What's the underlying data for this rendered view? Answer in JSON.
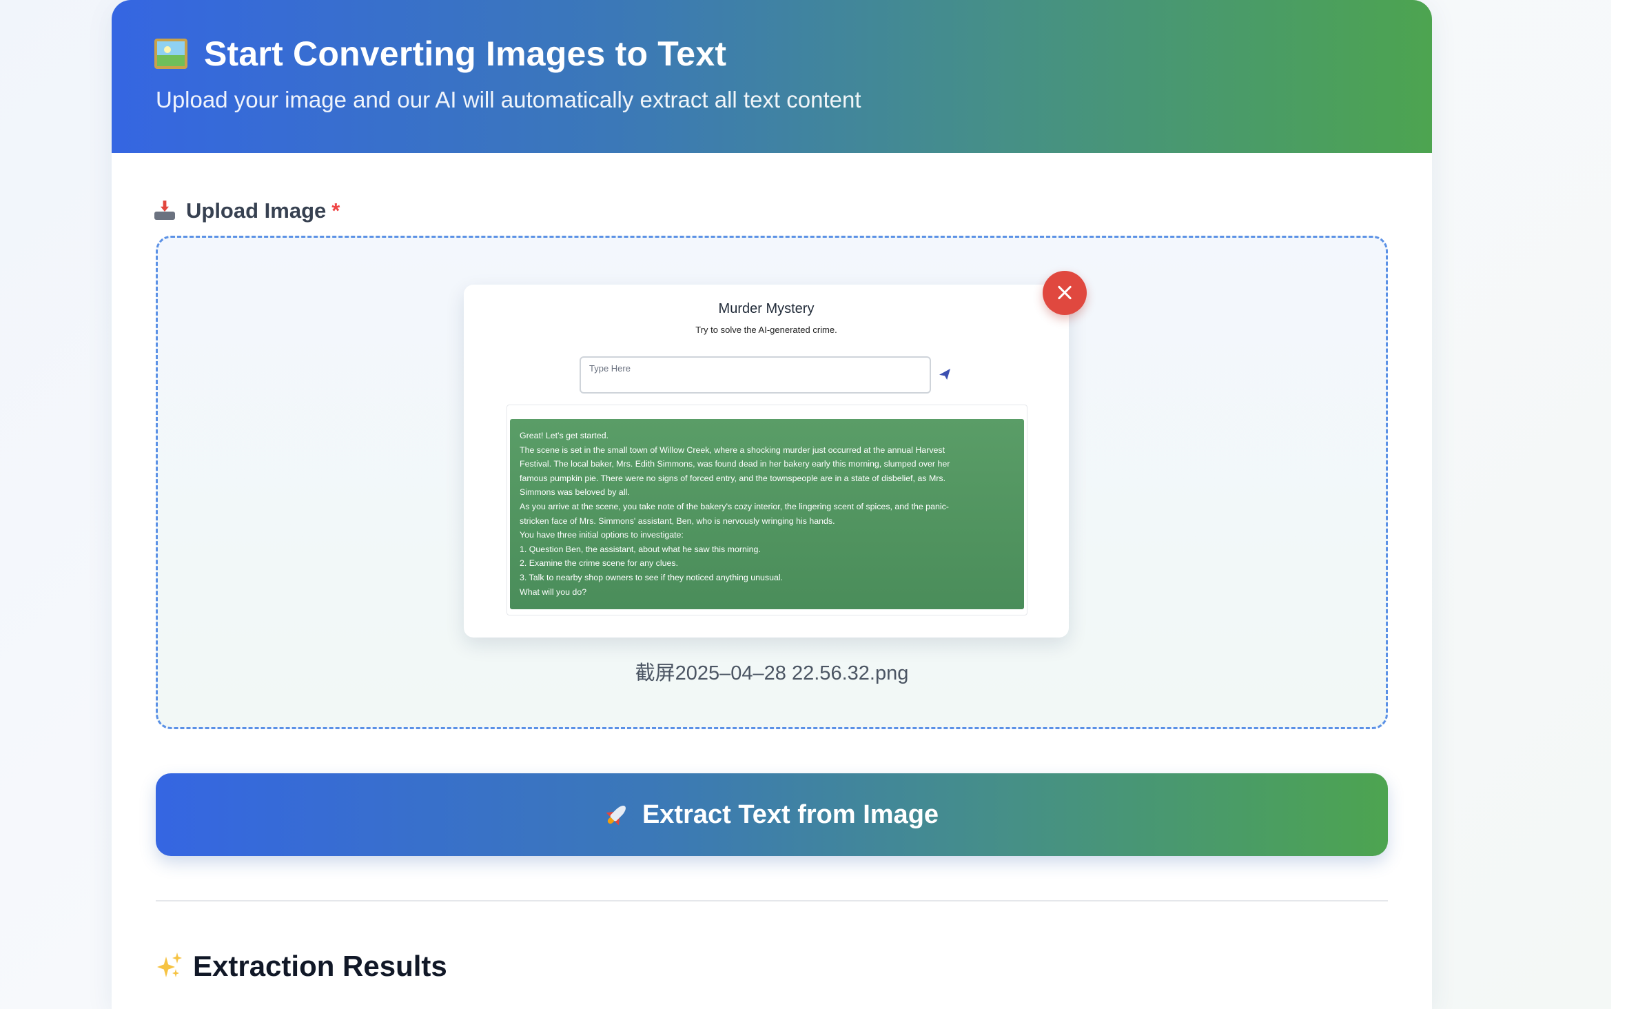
{
  "hero": {
    "title": "Start Converting Images to Text",
    "subtitle": "Upload your image and our AI will automatically extract all text content",
    "icon": "framed-picture-icon"
  },
  "upload": {
    "label": "Upload Image",
    "required_marker": "*",
    "icon": "inbox-tray-icon",
    "file_name": "截屏2025–04–28 22.56.32.png",
    "remove_icon": "close-icon",
    "preview": {
      "title": "Murder Mystery",
      "subtitle": "Try to solve the AI-generated crime.",
      "input_placeholder": "Type Here",
      "send_icon": "send-icon",
      "message_lines": [
        "Great! Let's get started.",
        "The scene is set in the small town of Willow Creek, where a shocking murder just occurred at the annual Harvest",
        "Festival. The local baker, Mrs. Edith Simmons, was found dead in her bakery early this morning, slumped over her",
        "famous pumpkin pie. There were no signs of forced entry, and the townspeople are in a state of disbelief, as Mrs.",
        "Simmons was beloved by all.",
        "As you arrive at the scene, you take note of the bakery's cozy interior, the lingering scent of spices, and the panic-",
        "stricken face of Mrs. Simmons' assistant, Ben, who is nervously wringing his hands.",
        "You have three initial options to investigate:",
        "1. Question Ben, the assistant, about what he saw this morning.",
        "2. Examine the crime scene for any clues.",
        "3. Talk to nearby shop owners to see if they noticed anything unusual.",
        "What will you do?"
      ]
    }
  },
  "actions": {
    "extract_label": "Extract Text from Image",
    "extract_icon": "rocket-icon"
  },
  "results": {
    "title": "Extraction Results",
    "icon": "sparkles-icon"
  },
  "colors": {
    "gradient_start": "#3566e2",
    "gradient_end": "#4da450",
    "required": "#ef4444",
    "close_button": "#e0483f",
    "message_bg": "#4a8d5a"
  }
}
